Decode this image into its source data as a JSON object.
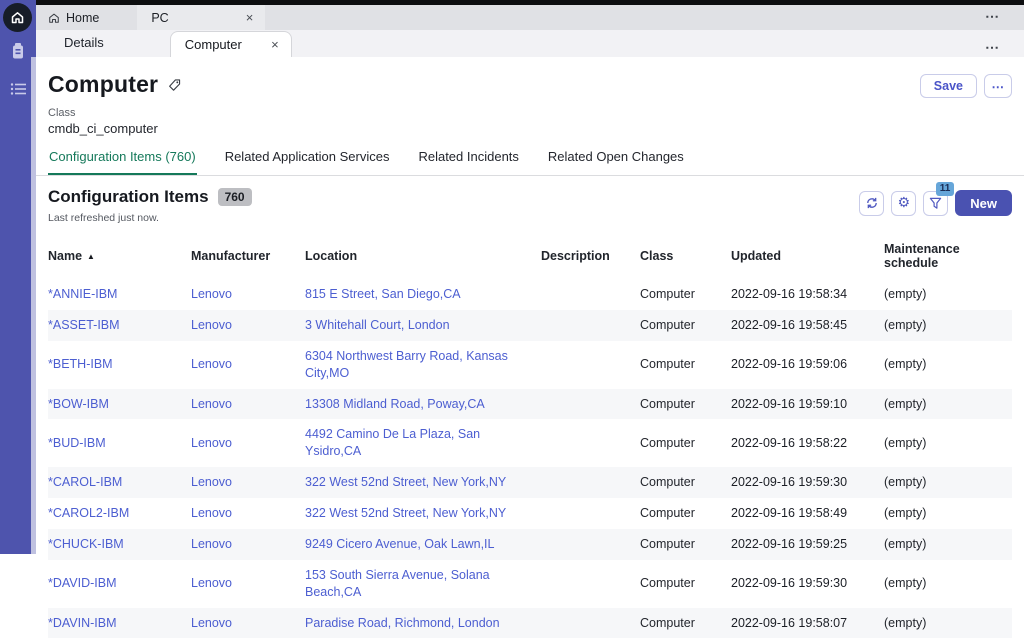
{
  "chrome": {
    "window_tabs": [
      {
        "label": "Home"
      },
      {
        "label": "PC"
      }
    ],
    "workspace_tabs": [
      {
        "label": "Details"
      },
      {
        "label": "Computer"
      }
    ]
  },
  "icons": {
    "more": "⋯",
    "close": "×",
    "gear": "⚙",
    "sort_asc": "▲"
  },
  "record": {
    "title": "Computer",
    "class_label": "Class",
    "class_value": "cmdb_ci_computer",
    "save_label": "Save"
  },
  "record_tabs": [
    {
      "label": "Configuration Items (760)",
      "active": true
    },
    {
      "label": "Related Application Services",
      "active": false
    },
    {
      "label": "Related Incidents",
      "active": false
    },
    {
      "label": "Related Open Changes",
      "active": false
    }
  ],
  "list": {
    "title": "Configuration Items",
    "count": "760",
    "refreshed": "Last refreshed just now.",
    "filter_badge": "11",
    "new_label": "New"
  },
  "table": {
    "columns": [
      "Name",
      "Manufacturer",
      "Location",
      "Description",
      "Class",
      "Updated",
      "Maintenance schedule"
    ],
    "rows": [
      {
        "name": "*ANNIE-IBM",
        "manufacturer": "Lenovo",
        "location": "815 E Street, San Diego,CA",
        "description": "",
        "class": "Computer",
        "updated": "2022-09-16 19:58:34",
        "maintenance": "(empty)"
      },
      {
        "name": "*ASSET-IBM",
        "manufacturer": "Lenovo",
        "location": "3 Whitehall Court, London",
        "description": "",
        "class": "Computer",
        "updated": "2022-09-16 19:58:45",
        "maintenance": "(empty)"
      },
      {
        "name": "*BETH-IBM",
        "manufacturer": "Lenovo",
        "location": "6304 Northwest Barry Road, Kansas City,MO",
        "description": "",
        "class": "Computer",
        "updated": "2022-09-16 19:59:06",
        "maintenance": "(empty)"
      },
      {
        "name": "*BOW-IBM",
        "manufacturer": "Lenovo",
        "location": "13308 Midland Road, Poway,CA",
        "description": "",
        "class": "Computer",
        "updated": "2022-09-16 19:59:10",
        "maintenance": "(empty)"
      },
      {
        "name": "*BUD-IBM",
        "manufacturer": "Lenovo",
        "location": "4492 Camino De La Plaza, San Ysidro,CA",
        "description": "",
        "class": "Computer",
        "updated": "2022-09-16 19:58:22",
        "maintenance": "(empty)"
      },
      {
        "name": "*CAROL-IBM",
        "manufacturer": "Lenovo",
        "location": "322 West 52nd Street, New York,NY",
        "description": "",
        "class": "Computer",
        "updated": "2022-09-16 19:59:30",
        "maintenance": "(empty)"
      },
      {
        "name": "*CAROL2-IBM",
        "manufacturer": "Lenovo",
        "location": "322 West 52nd Street, New York,NY",
        "description": "",
        "class": "Computer",
        "updated": "2022-09-16 19:58:49",
        "maintenance": "(empty)"
      },
      {
        "name": "*CHUCK-IBM",
        "manufacturer": "Lenovo",
        "location": "9249 Cicero Avenue, Oak Lawn,IL",
        "description": "",
        "class": "Computer",
        "updated": "2022-09-16 19:59:25",
        "maintenance": "(empty)"
      },
      {
        "name": "*DAVID-IBM",
        "manufacturer": "Lenovo",
        "location": "153 South Sierra Avenue, Solana Beach,CA",
        "description": "",
        "class": "Computer",
        "updated": "2022-09-16 19:59:30",
        "maintenance": "(empty)"
      },
      {
        "name": "*DAVIN-IBM",
        "manufacturer": "Lenovo",
        "location": "Paradise Road, Richmond, London",
        "description": "",
        "class": "Computer",
        "updated": "2022-09-16 19:58:07",
        "maintenance": "(empty)"
      }
    ]
  },
  "colors": {
    "sidebar_purple": "#4e54ad",
    "accent_indigo": "#4a52b1",
    "active_tab_green": "#15795a",
    "link_blue": "#4c5ed1",
    "filter_badge_blue": "#66a6d9"
  }
}
